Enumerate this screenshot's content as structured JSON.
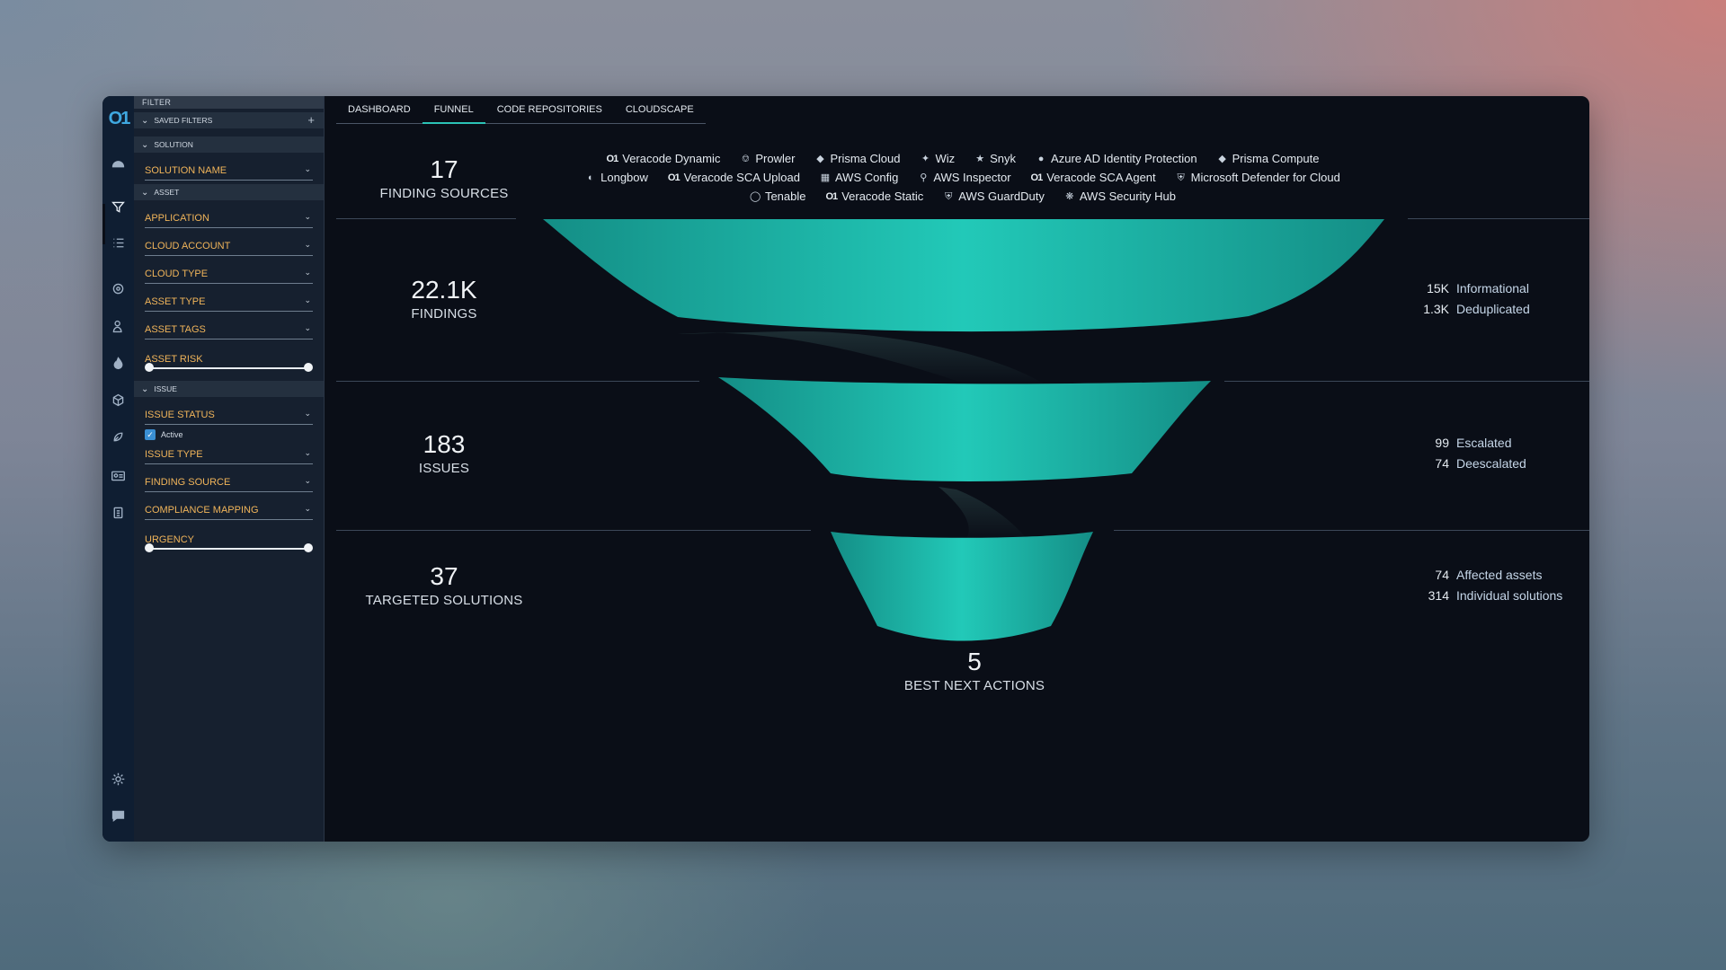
{
  "filter": {
    "header": "FILTER",
    "saved_filters": "SAVED FILTERS",
    "solution_section": "SOLUTION",
    "solution_name": "SOLUTION NAME",
    "asset_section": "ASSET",
    "application": "APPLICATION",
    "cloud_account": "CLOUD ACCOUNT",
    "cloud_type": "CLOUD TYPE",
    "asset_type": "ASSET TYPE",
    "asset_tags": "ASSET TAGS",
    "asset_risk": "ASSET RISK",
    "issue_section": "ISSUE",
    "issue_status": "ISSUE STATUS",
    "active_label": "Active",
    "issue_type": "ISSUE TYPE",
    "finding_source": "FINDING SOURCE",
    "compliance_mapping": "COMPLIANCE MAPPING",
    "urgency": "URGENCY"
  },
  "tabs": [
    "DASHBOARD",
    "FUNNEL",
    "CODE REPOSITORIES",
    "CLOUDSCAPE"
  ],
  "active_tab": "FUNNEL",
  "stats": {
    "sources": {
      "value": "17",
      "label": "FINDING SOURCES"
    },
    "findings": {
      "value": "22.1K",
      "label": "FINDINGS"
    },
    "issues": {
      "value": "183",
      "label": "ISSUES"
    },
    "solutions": {
      "value": "37",
      "label": "TARGETED SOLUTIONS"
    },
    "actions": {
      "value": "5",
      "label": "BEST NEXT ACTIONS"
    }
  },
  "sources_row1": [
    "Veracode Dynamic",
    "Prowler",
    "Prisma Cloud",
    "Wiz",
    "Snyk",
    "Azure AD Identity Protection",
    "Prisma Compute"
  ],
  "sources_row2": [
    "Longbow",
    "Veracode SCA Upload",
    "AWS Config",
    "AWS Inspector",
    "Veracode SCA Agent",
    "Microsoft Defender for Cloud"
  ],
  "sources_row3": [
    "Tenable",
    "Veracode Static",
    "AWS GuardDuty",
    "AWS Security Hub"
  ],
  "findings_breakdown": [
    {
      "n": "15K",
      "t": "Informational"
    },
    {
      "n": "1.3K",
      "t": "Deduplicated"
    }
  ],
  "issues_breakdown": [
    {
      "n": "99",
      "t": "Escalated"
    },
    {
      "n": "74",
      "t": "Deescalated"
    }
  ],
  "solutions_breakdown": [
    {
      "n": "74",
      "t": "Affected assets"
    },
    {
      "n": "314",
      "t": "Individual solutions"
    }
  ],
  "colors": {
    "accent": "#2bc3b6",
    "label_orange": "#f0b45a",
    "teal_funnel": "#1fbfaf"
  }
}
